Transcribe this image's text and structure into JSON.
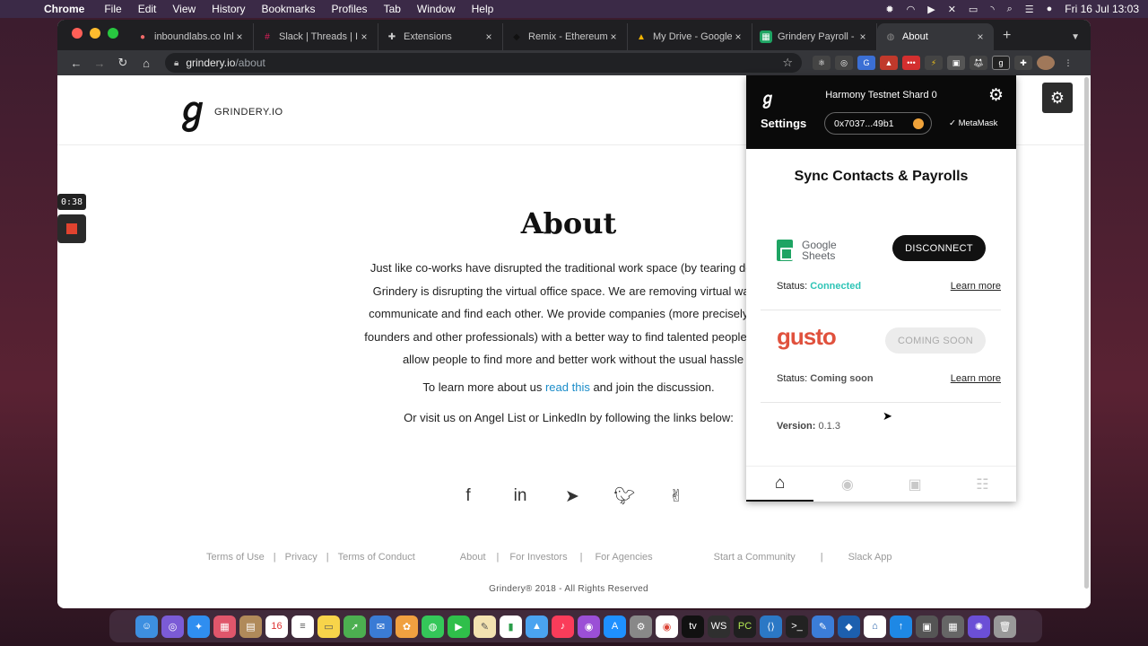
{
  "menubar": {
    "app": "Chrome",
    "items": [
      "File",
      "Edit",
      "View",
      "History",
      "Bookmarks",
      "Profiles",
      "Tab",
      "Window",
      "Help"
    ],
    "clock": "Fri 16 Jul  13:03"
  },
  "tabs": [
    {
      "label": "inboundlabs.co Inb",
      "icon": "asana-icon",
      "color": "#f06a6a"
    },
    {
      "label": "Slack | Threads | Inb",
      "icon": "slack-icon",
      "color": "#e01e5a"
    },
    {
      "label": "Extensions",
      "icon": "puzzle-icon",
      "color": "#bbbbbb"
    },
    {
      "label": "Remix - Ethereum I",
      "icon": "remix-icon",
      "color": "#333333"
    },
    {
      "label": "My Drive - Google D",
      "icon": "drive-icon",
      "color": "#f4b400"
    },
    {
      "label": "Grindery Payroll - G",
      "icon": "sheets-icon",
      "color": "#1ea463"
    },
    {
      "label": "About",
      "icon": "globe-icon",
      "color": "#888888"
    }
  ],
  "omnibox": {
    "host": "grindery.io",
    "path": "/about"
  },
  "site": {
    "logo_text": "GRINDERY.IO",
    "title": "About",
    "body_lines": [
      "Just like co-works have disrupted the traditional work space (by tearing down c",
      "Grindery is disrupting the virtual office space. We are removing virtual walls, a",
      "communicate and find each other. We provide companies (more precisely proje",
      "founders and other professionals) with a better way to find talented people. On th",
      "allow people to find more and better work without the usual hassle"
    ],
    "learn_prefix": "To learn more about us ",
    "learn_link": "read this",
    "learn_suffix": " and join the discussion.",
    "visit_line": "Or visit us on Angel List or LinkedIn by following the links below:",
    "footer_links": [
      "Terms of Use",
      "|",
      "Privacy",
      "|",
      "Terms of Conduct",
      "About",
      "|",
      "For Investors",
      "|",
      "For Agencies",
      "Start a Community",
      "|",
      "Slack App"
    ],
    "copyright": "Grindery® 2018 - All Rights Reserved"
  },
  "recorder": {
    "time": "0:38"
  },
  "popup": {
    "network": "Harmony Testnet Shard 0",
    "settings_label": "Settings",
    "address": "0x7037...49b1",
    "wallet": "MetaMask",
    "title": "Sync Contacts & Payrolls",
    "google": {
      "name_line1": "Google",
      "name_line2": "Sheets",
      "button": "DISCONNECT",
      "status_label": "Status: ",
      "status_value": "Connected",
      "learn": "Learn more"
    },
    "gusto": {
      "name": "gusto",
      "button": "COMING SOON",
      "status_label": "Status: ",
      "status_value": "Coming soon",
      "learn": "Learn more"
    },
    "version_label": "Version: ",
    "version_value": "0.1.3"
  },
  "colors": {
    "accent": "#2ec4b6",
    "link": "#1a8cc9",
    "gusto": "#e0513d",
    "sheets": "#1ea463"
  }
}
